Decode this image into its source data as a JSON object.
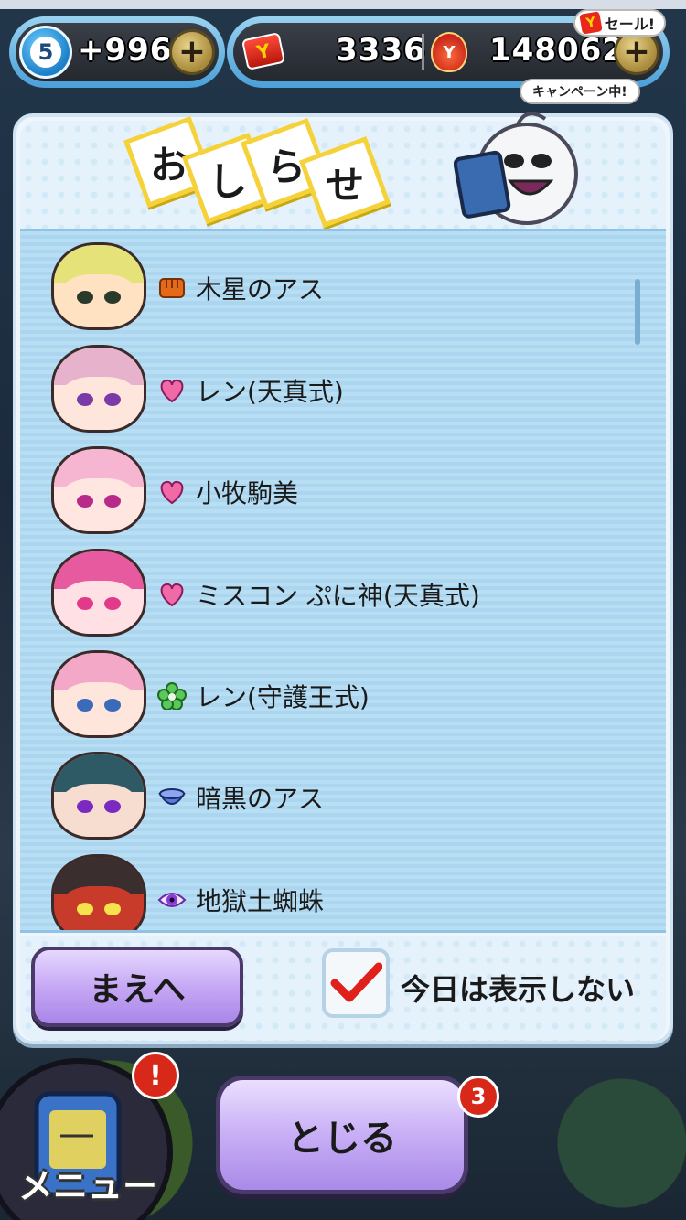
{
  "hud": {
    "level_badge": "5",
    "lives_count": "+996",
    "ycard_icon_text": "Y",
    "ycard_count": "3336",
    "coin_icon_text": "Y",
    "coin_count": "148062",
    "plus_symbol": "+",
    "sale_text": "セール!",
    "campaign_text": "キャンペーン中!"
  },
  "dialog": {
    "title_chars": [
      "お",
      "し",
      "ら",
      "せ"
    ],
    "rows": [
      {
        "name": "木星のアス",
        "icon": "fist-icon",
        "hair": "#e6e27a",
        "face": "#ffe2c2",
        "eye": "#2a3a2a"
      },
      {
        "name": "レン(天真式)",
        "icon": "heart-icon",
        "hair": "#e6b2cc",
        "face": "#ffe6dc",
        "eye": "#7a3aa8"
      },
      {
        "name": "小牧駒美",
        "icon": "heart-icon",
        "hair": "#f6b6d2",
        "face": "#ffe6e0",
        "eye": "#b82a8a"
      },
      {
        "name": "ミスコン ぷに神(天真式)",
        "icon": "heart-icon",
        "hair": "#e85aa0",
        "face": "#ffe0e4",
        "eye": "#e23a8a"
      },
      {
        "name": "レン(守護王式)",
        "icon": "flower-icon",
        "hair": "#f2a8c6",
        "face": "#ffe6dc",
        "eye": "#3a6ab8"
      },
      {
        "name": "暗黒のアス",
        "icon": "bowl-icon",
        "hair": "#2e5a66",
        "face": "#f6ddd0",
        "eye": "#7a2ac0"
      },
      {
        "name": "地獄土蜘蛛",
        "icon": "eye-icon",
        "hair": "#3a2e2e",
        "face": "#c83a2a",
        "eye": "#f6e24a"
      }
    ],
    "prev_label": "まえへ",
    "dont_show_label": "今日は表示しない",
    "dont_show_checked": true
  },
  "bottom": {
    "menu_label": "メニュー",
    "menu_badge": "!",
    "close_label": "とじる",
    "right_badge": "3"
  },
  "colors": {
    "accent": "#f6d23a",
    "button_purple": "#c6a8f4",
    "list_blue": "#b8def4",
    "check_red": "#e0201a"
  }
}
